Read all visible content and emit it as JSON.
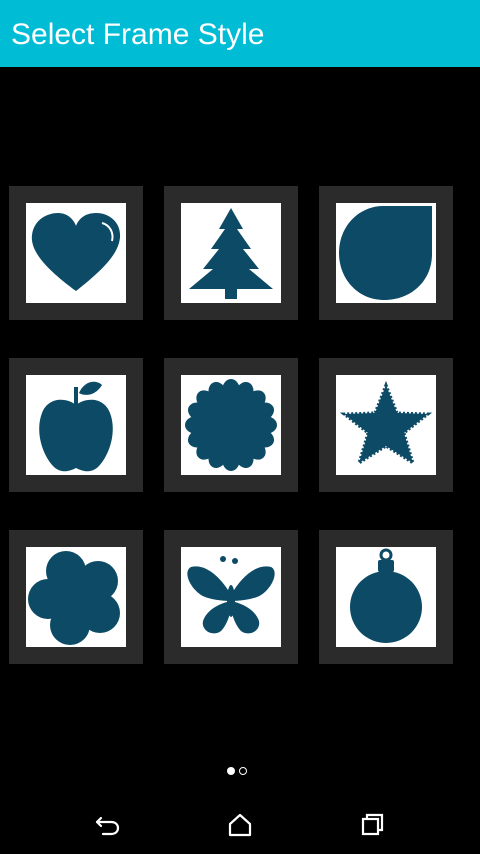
{
  "app_bar": {
    "title": "Select Frame Style"
  },
  "frames": [
    {
      "name": "heart"
    },
    {
      "name": "christmas-tree"
    },
    {
      "name": "teardrop"
    },
    {
      "name": "apple"
    },
    {
      "name": "sunflower"
    },
    {
      "name": "star"
    },
    {
      "name": "flower"
    },
    {
      "name": "butterfly"
    },
    {
      "name": "ornament"
    }
  ],
  "pager": {
    "page": 1,
    "total_pages": 2
  },
  "nav": {
    "back": "back-icon",
    "home": "home-icon",
    "recents": "recents-icon"
  },
  "colors": {
    "accent": "#00bcd4",
    "shape": "#0c4a66",
    "tile_bg": "#2b2b2b",
    "background": "#000000"
  }
}
